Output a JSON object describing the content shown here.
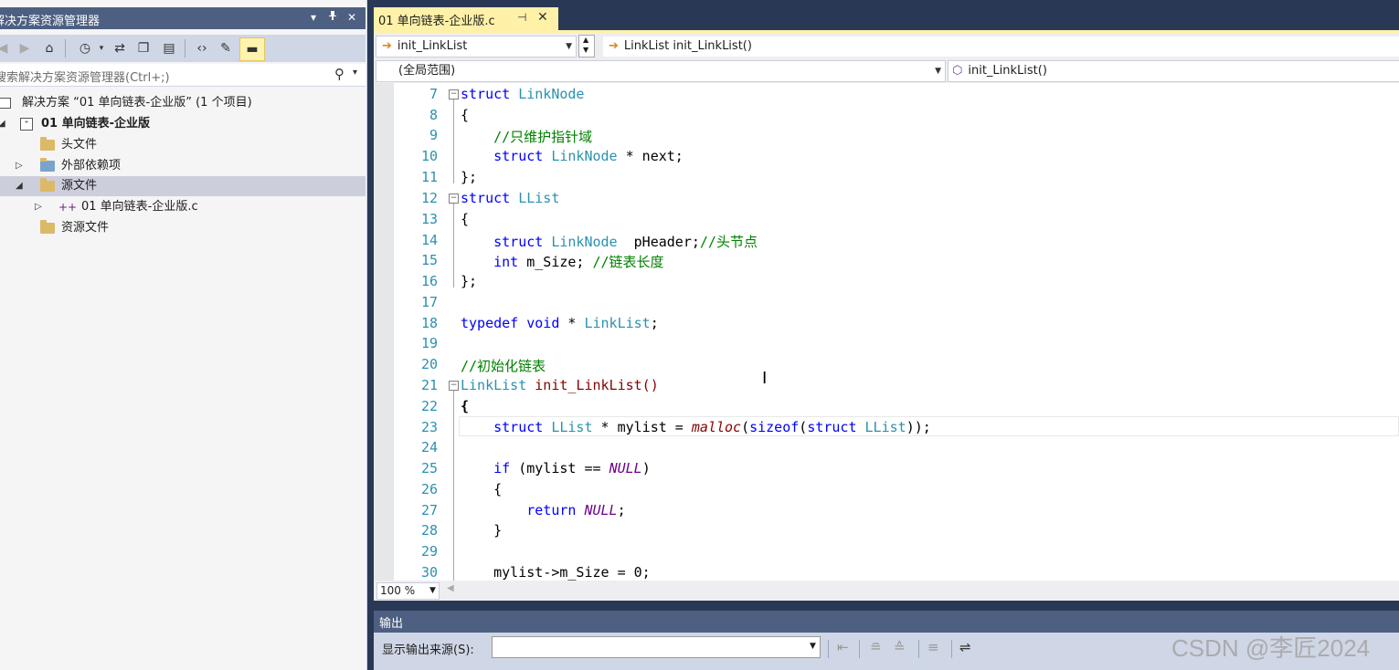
{
  "solution_explorer": {
    "title": "解决方案资源管理器",
    "title_buttons": [
      "▾",
      "ꟷ",
      "✕"
    ],
    "search_placeholder": "搜索解决方案资源管理器(Ctrl+;)",
    "tree": [
      {
        "label": "解决方案 “01 单向链表-企业版” (1 个项目)",
        "icon": "solution-icon"
      },
      {
        "label": "01 单向链表-企业版",
        "icon": "project-icon",
        "expanded": true,
        "bold": true
      },
      {
        "label": "头文件",
        "icon": "folder-icon"
      },
      {
        "label": "外部依赖项",
        "icon": "external-deps-icon",
        "expanded": false
      },
      {
        "label": "源文件",
        "icon": "folder-icon",
        "expanded": true,
        "selected": true
      },
      {
        "label": "01 单向链表-企业版.c",
        "icon": "c-file-icon",
        "expanded": false
      },
      {
        "label": "资源文件",
        "icon": "folder-icon"
      }
    ]
  },
  "editor": {
    "tab_label": "01 单向链表-企业版.c",
    "nav_function": "init_LinkList",
    "nav_signature": "LinkList init_LinkList()",
    "scope": "(全局范围)",
    "member": "init_LinkList()",
    "zoom": "100 %",
    "line_numbers": [
      "7",
      "8",
      "9",
      "10",
      "11",
      "12",
      "13",
      "14",
      "15",
      "16",
      "17",
      "18",
      "19",
      "20",
      "21",
      "22",
      "23",
      "24",
      "25",
      "26",
      "27",
      "28",
      "29",
      "30"
    ],
    "code": {
      "l7a": "struct",
      "l7b": " LinkNode",
      "l8": "{",
      "l9": "    //只维护指针域",
      "l10a": "    struct",
      "l10b": " LinkNode",
      "l10c": " * next;",
      "l11": "};",
      "l12a": "struct",
      "l12b": " LList",
      "l13": "{",
      "l14a": "    struct",
      "l14b": " LinkNode",
      "l14c": "  pHeader;",
      "l14d": "//头节点",
      "l15a": "    int",
      "l15b": " m_Size; ",
      "l15c": "//链表长度",
      "l16": "};",
      "l18a": "typedef",
      "l18b": " void",
      "l18c": " * ",
      "l18d": "LinkList",
      "l18e": ";",
      "l20": "//初始化链表",
      "l21a": "LinkList",
      "l21b": " init_LinkList()",
      "l22": "{",
      "l23a": "    struct",
      "l23b": " LList",
      "l23c": " * mylist = ",
      "l23d": "malloc",
      "l23e": "(",
      "l23f": "sizeof",
      "l23g": "(",
      "l23h": "struct",
      "l23i": " LList",
      "l23j": "));",
      "l25a": "    if",
      "l25b": " (mylist == ",
      "l25c": "NULL",
      "l25d": ")",
      "l26": "    {",
      "l27a": "        return",
      "l27b": " NULL",
      "l27c": ";",
      "l28": "    }",
      "l30": "    mylist->m_Size = 0;"
    }
  },
  "output": {
    "title": "输出",
    "source_label": "显示输出来源(S):",
    "source_value": ""
  },
  "watermark": "CSDN @李匠2024",
  "colors": {
    "chrome_dark": "#293955",
    "title_bar": "#4d6082",
    "active_tab": "#fff1a8",
    "keyword": "#0000ff",
    "type": "#2b91af",
    "comment": "#008000",
    "macro": "#6f008a"
  }
}
